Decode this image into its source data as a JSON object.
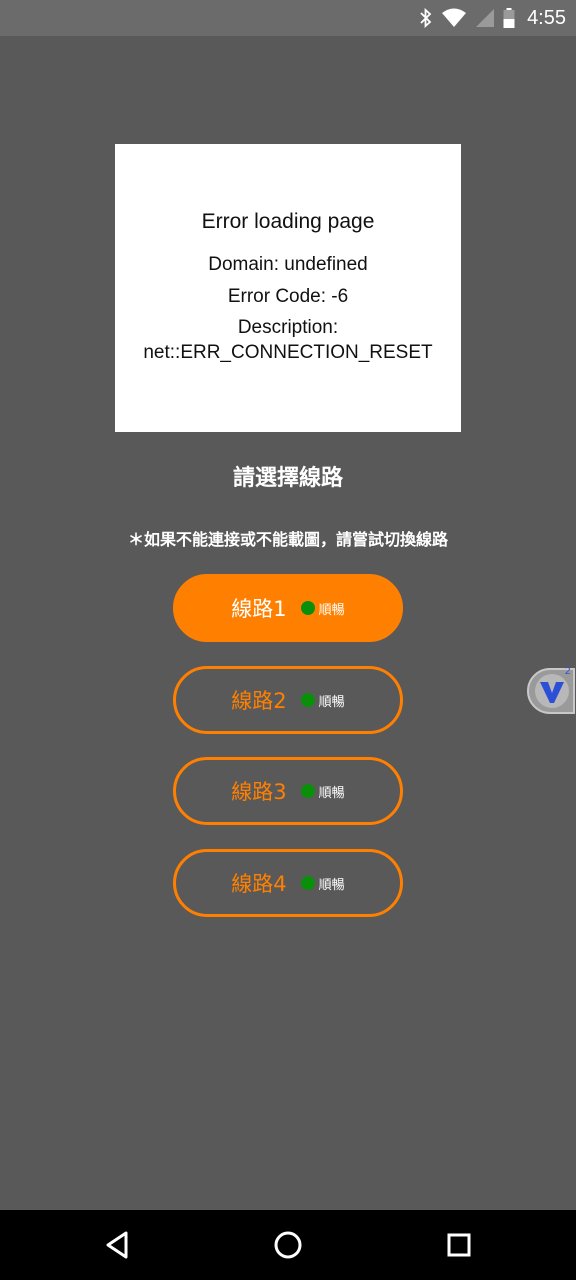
{
  "status_bar": {
    "time": "4:55",
    "icons": [
      "bluetooth-icon",
      "wifi-icon",
      "signal-icon",
      "battery-icon"
    ]
  },
  "error": {
    "title": "Error loading page",
    "domain": "Domain: undefined",
    "code": "Error Code: -6",
    "description_label": "Description:",
    "description": "net::ERR_CONNECTION_RESET"
  },
  "main": {
    "heading": "請選擇線路",
    "note": "＊如果不能連接或不能載圖，請嘗試切換線路"
  },
  "routes": [
    {
      "label": "線路1",
      "status": "順暢",
      "active": true
    },
    {
      "label": "線路2",
      "status": "順暢",
      "active": false
    },
    {
      "label": "線路3",
      "status": "順暢",
      "active": false
    },
    {
      "label": "線路4",
      "status": "順暢",
      "active": false
    }
  ],
  "floating_widget": {
    "icon": "v-logo-icon",
    "badge": "2"
  },
  "colors": {
    "accent": "#ff8000",
    "status_dot": "#0a8f0a",
    "background": "#595959"
  },
  "nav_bar": {
    "buttons": [
      "back-icon",
      "home-icon",
      "recents-icon"
    ]
  }
}
